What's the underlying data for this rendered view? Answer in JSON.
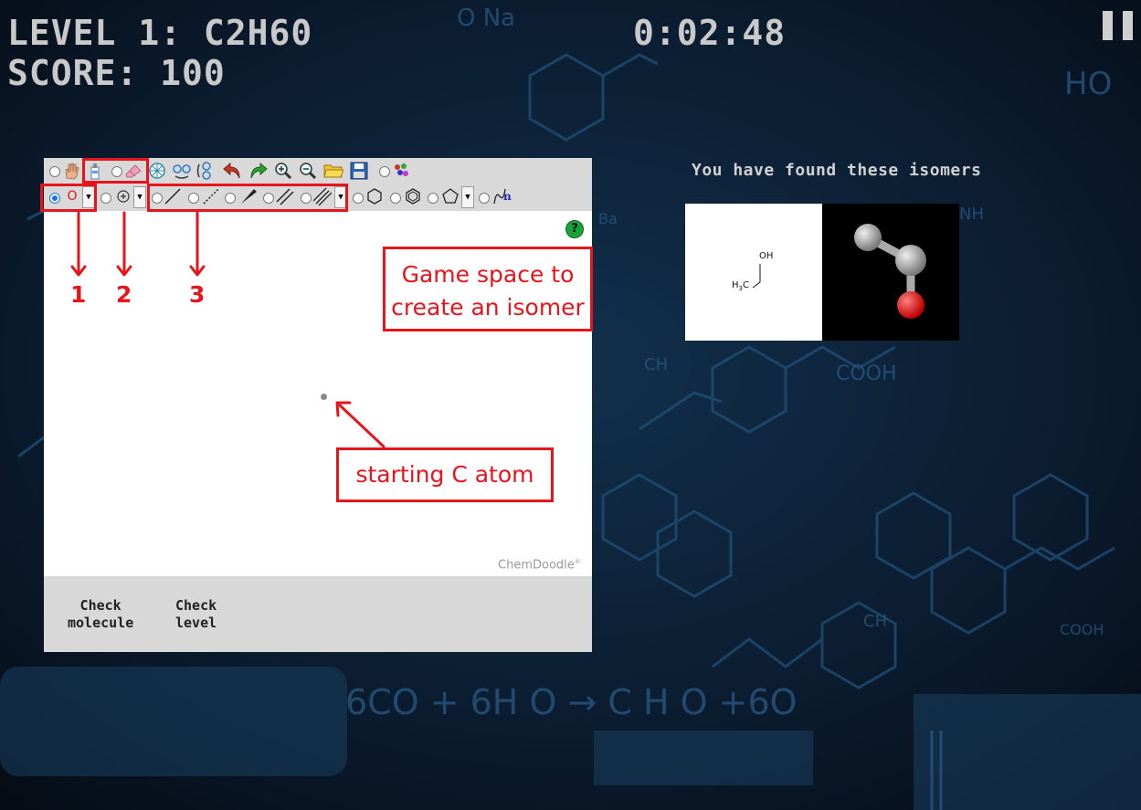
{
  "hud": {
    "level": "LEVEL 1: C2H60",
    "score": "SCORE: 100",
    "timer": "0:02:48"
  },
  "editor": {
    "toolbar1": [
      "hand-tool",
      "lasso-tool",
      "eraser-tool",
      "clear-tool",
      "flip-horizontal-tool",
      "flip-vertical-tool",
      "undo-tool",
      "redo-tool",
      "zoom-in-tool",
      "zoom-out-tool",
      "open-tool",
      "save-tool",
      "templates-tool"
    ],
    "atom_label": "O",
    "canvas": {
      "watermark": "ChemDoodle",
      "watermark_mark": "®",
      "help_label": "?"
    },
    "buttons": {
      "check_molecule": "Check\nmolecule",
      "check_level": "Check\nlevel"
    },
    "chain_label": "n"
  },
  "annotations": {
    "numbers": [
      "1",
      "2",
      "3"
    ],
    "game_space": "Game space to create an isomer",
    "starting_atom": "starting C atom",
    "color": "#e8141b"
  },
  "found": {
    "title": "You have found these isomers",
    "isomer": {
      "oh_label": "OH",
      "ch3_label": "H",
      "ch3_sub": "3",
      "ch3_c": "C"
    }
  },
  "background_text": [
    "O Na+",
    "HO",
    "6CO2 + 6H2O → C6H12O6 + 6O2",
    "COOH",
    "CH2",
    "CH3",
    "NH2",
    "COOH",
    "Ba",
    "(Ba)"
  ]
}
